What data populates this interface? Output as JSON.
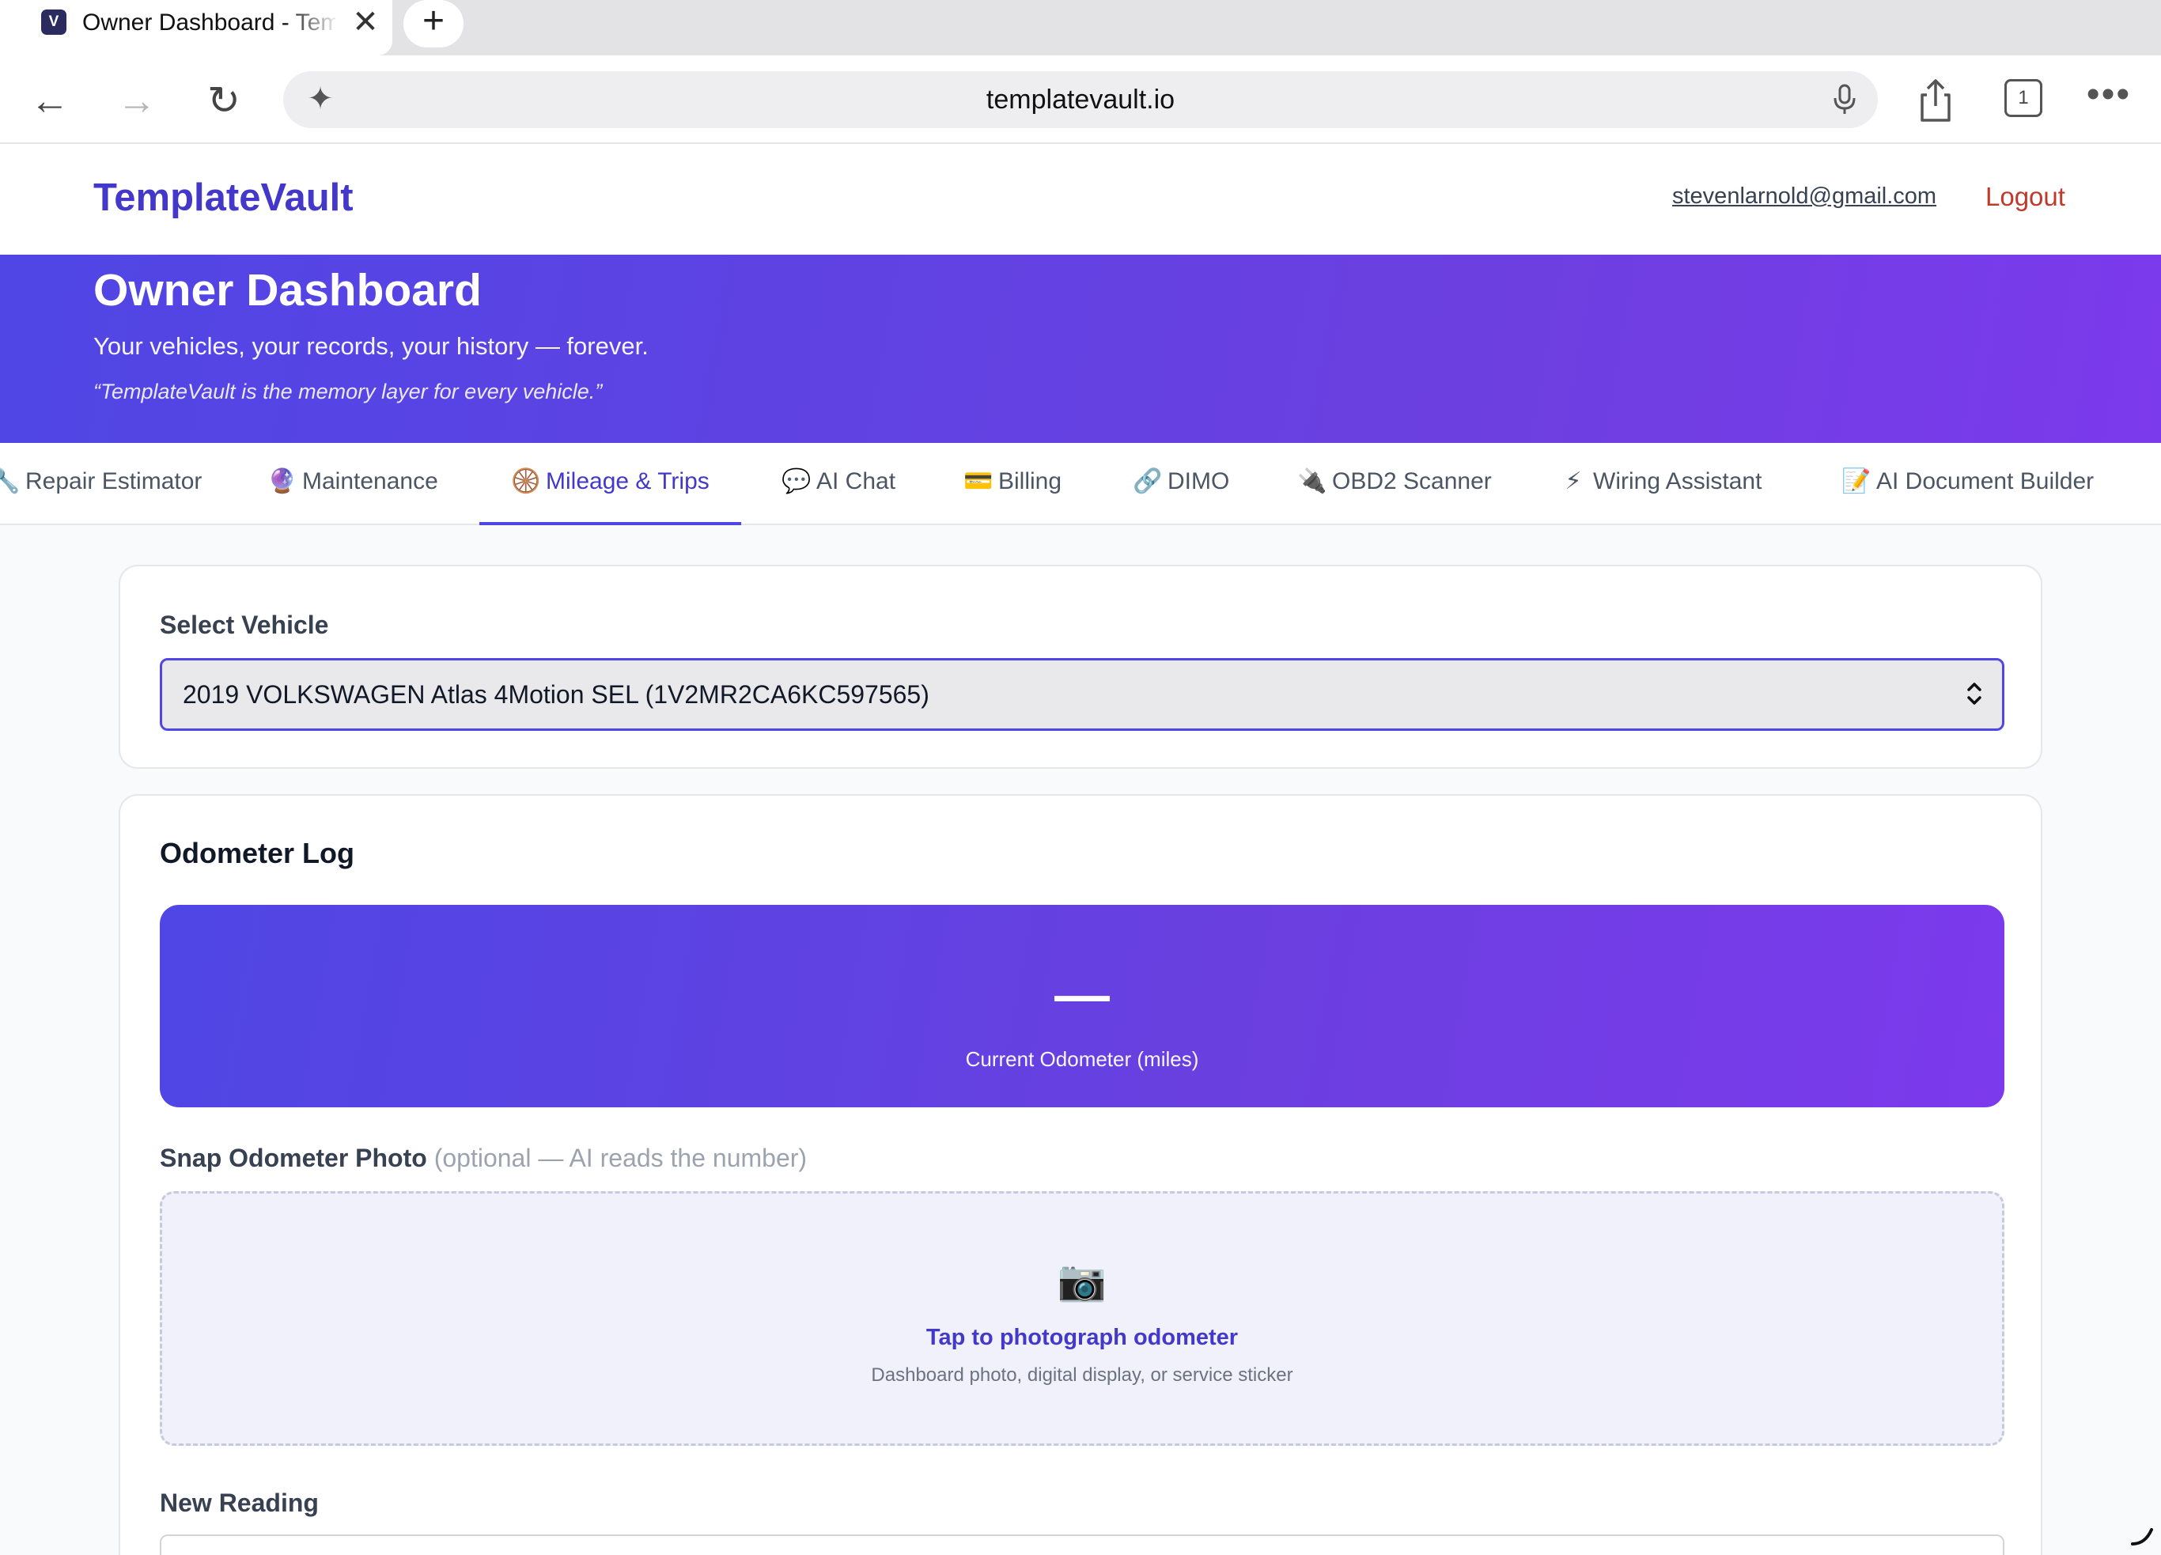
{
  "browser": {
    "tab_title": "Owner Dashboard - TemplateVault",
    "favicon_letter": "V",
    "url": "templatevault.io",
    "tab_count": "1"
  },
  "header": {
    "brand": "TemplateVault",
    "email": "stevenlarnold@gmail.com",
    "logout": "Logout"
  },
  "hero": {
    "title": "Owner Dashboard",
    "subtitle": "Your vehicles, your records, your history — forever.",
    "quote": "“TemplateVault is the memory layer for every vehicle.”"
  },
  "nav": {
    "tabs": [
      {
        "icon": "🔧",
        "label": "Repair Estimator",
        "active": false
      },
      {
        "icon": "🔮",
        "label": "Maintenance",
        "active": false
      },
      {
        "icon": "🛞",
        "label": "Mileage & Trips",
        "active": true
      },
      {
        "icon": "💬",
        "label": "AI Chat",
        "active": false
      },
      {
        "icon": "💳",
        "label": "Billing",
        "active": false
      },
      {
        "icon": "🔗",
        "label": "DIMO",
        "active": false
      },
      {
        "icon": "🔌",
        "label": "OBD2 Scanner",
        "active": false
      },
      {
        "icon": "⚡",
        "label": "Wiring Assistant",
        "active": false
      },
      {
        "icon": "📝",
        "label": "AI Document Builder",
        "active": false
      }
    ]
  },
  "vehicle": {
    "label": "Select Vehicle",
    "selected": "2019 VOLKSWAGEN Atlas 4Motion SEL (1V2MR2CA6KC597565)"
  },
  "odometer": {
    "title": "Odometer Log",
    "current_value": "—",
    "current_caption": "Current Odometer (miles)",
    "photo_label": "Snap Odometer Photo",
    "photo_hint": "(optional — AI reads the number)",
    "camera_icon": "📷",
    "dropzone_title": "Tap to photograph odometer",
    "dropzone_sub": "Dashboard photo, digital display, or service sticker",
    "new_reading_label": "New Reading"
  },
  "colors": {
    "accent": "#4f46e5",
    "accent_purple": "#7c3aed",
    "logout": "#c0392b"
  }
}
